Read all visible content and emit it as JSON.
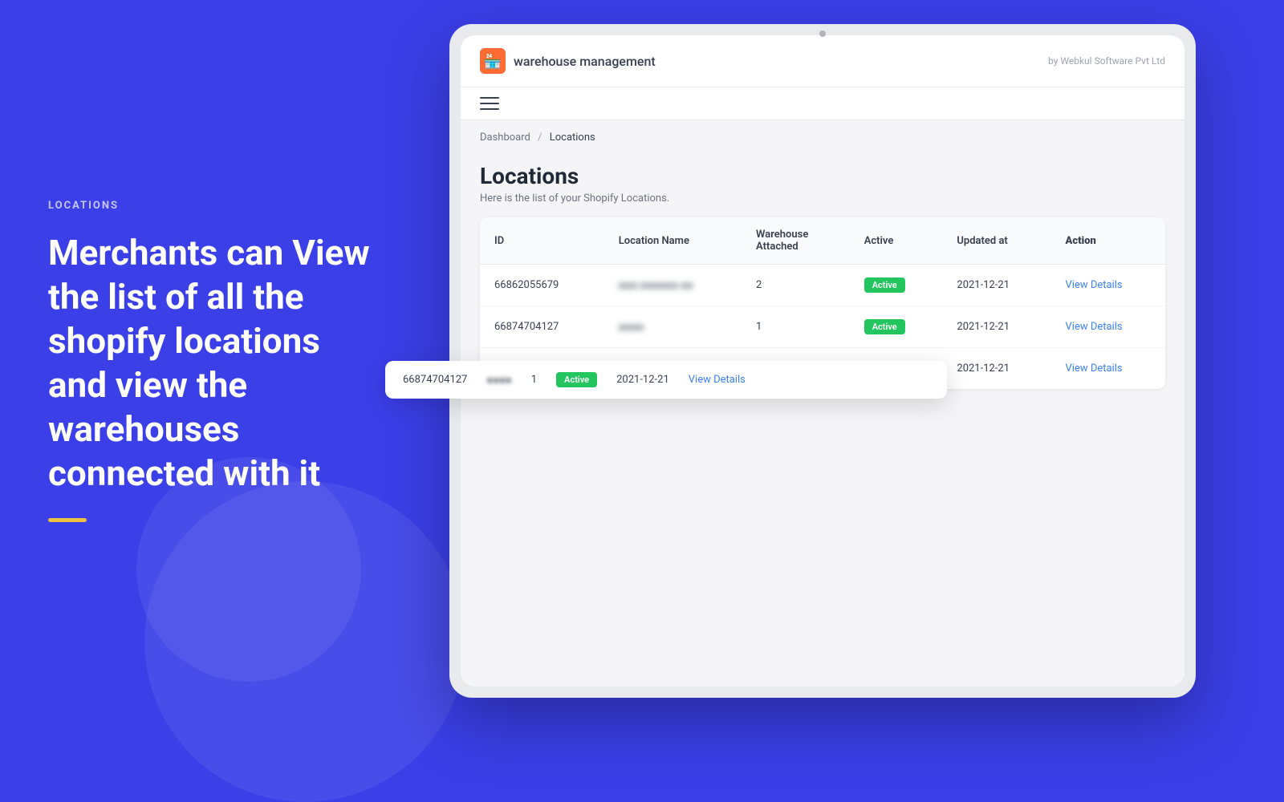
{
  "left": {
    "section_label": "LOCATIONS",
    "main_text": "Merchants can View the list of all the shopify locations and view the warehouses connected with it"
  },
  "app": {
    "logo_emoji": "🏪",
    "title": "warehouse management",
    "by_label": "by Webkul Software Pvt Ltd",
    "hamburger_label": "Menu"
  },
  "breadcrumb": {
    "dashboard": "Dashboard",
    "separator": "/",
    "current": "Locations"
  },
  "page": {
    "title": "Locations",
    "subtitle": "Here is the list of your Shopify Locations."
  },
  "table": {
    "columns": [
      "ID",
      "Location Name",
      "Warehouse Attached",
      "Active",
      "Updated at",
      "Action"
    ],
    "rows": [
      {
        "id": "66862055679",
        "location_name": "●●● ●●●●●● ●●",
        "warehouse_attached": "2",
        "active": "Active",
        "updated_at": "2021-12-21",
        "action": "View Details"
      },
      {
        "id": "66874704127",
        "location_name": "●●●●",
        "warehouse_attached": "1",
        "active": "Active",
        "updated_at": "2021-12-21",
        "action": "View Details"
      },
      {
        "id": "66874704127",
        "location_name": "●●●●",
        "warehouse_attached": "1",
        "active": "Active",
        "updated_at": "2021-12-21",
        "action": "View Details"
      }
    ]
  },
  "floating_row": {
    "id": "66874704127",
    "location_name": "●●●●",
    "warehouse_attached": "1",
    "active": "Active",
    "updated_at": "2021-12-21",
    "action": "View Details"
  }
}
